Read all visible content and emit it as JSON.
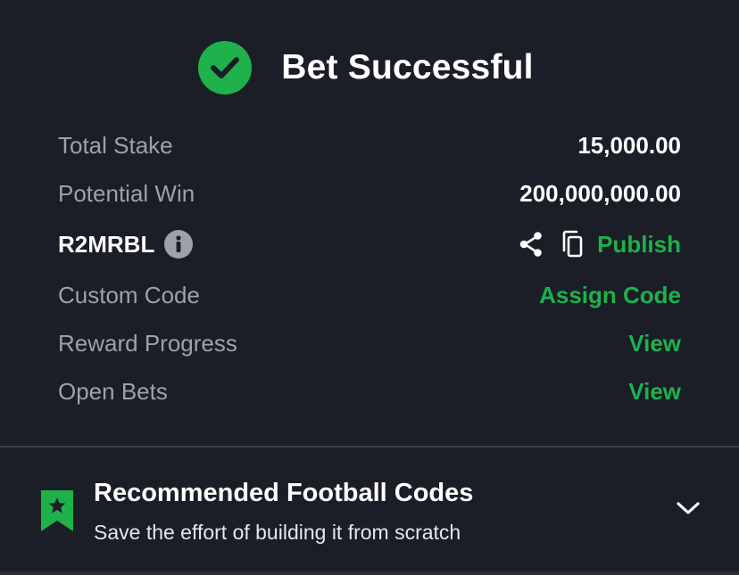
{
  "header": {
    "title": "Bet Successful",
    "status_icon": "check-circle-icon"
  },
  "details": {
    "total_stake_label": "Total Stake",
    "total_stake_value": "15,000.00",
    "potential_win_label": "Potential Win",
    "potential_win_value": "200,000,000.00",
    "booking_code": "R2MRBL",
    "publish_label": "Publish",
    "custom_code_label": "Custom Code",
    "assign_code_label": "Assign Code",
    "reward_progress_label": "Reward Progress",
    "reward_progress_action": "View",
    "open_bets_label": "Open Bets",
    "open_bets_action": "View"
  },
  "recommend": {
    "title": "Recommended Football Codes",
    "subtitle": "Save the effort of building it from scratch"
  },
  "colors": {
    "background": "#1b1e26",
    "accent_green": "#1eb14c",
    "muted_text": "#9da1ab",
    "text": "#ffffff"
  }
}
